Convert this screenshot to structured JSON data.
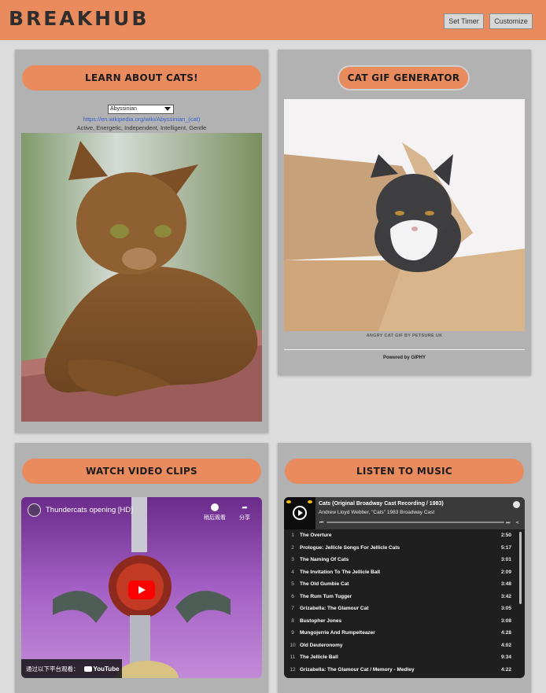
{
  "header": {
    "logo": "BREAKHUB",
    "set_timer_label": "Set Timer",
    "customize_label": "Customize",
    "brand_color": "#e98b5d"
  },
  "learn": {
    "title": "LEARN ABOUT CATS!",
    "breed_select": "Abyssinian",
    "wiki_link": "https://en.wikipedia.org/wiki/Abyssinian_(cat)",
    "traits": "Active, Energetic, Independent, Intelligent, Gentle"
  },
  "gif": {
    "title": "CAT GIF GENERATOR",
    "credit": "ANGRY CAT GIF BY PETSURE UK",
    "powered_by": "Powered by GIPHY"
  },
  "video": {
    "title": "WATCH VIDEO CLIPS",
    "video_title": "Thundercats opening [HD]",
    "watch_later": "稍后观看",
    "share": "分享",
    "platform_text": "通过以下平台观看：",
    "platform_logo": "YouTube"
  },
  "music": {
    "title": "LISTEN TO MUSIC",
    "album": "Cats (Original Broadway Cast Recording / 1983)",
    "artist": "Andrew Lloyd Webber, \"Cats\" 1983 Broadway Cast",
    "tracks": [
      {
        "n": "1",
        "title": "The Overture",
        "dur": "2:50"
      },
      {
        "n": "2",
        "title": "Prologue: Jellicle Songs For Jellicle Cats",
        "dur": "5:17"
      },
      {
        "n": "3",
        "title": "The Naming Of Cats",
        "dur": "3:01"
      },
      {
        "n": "4",
        "title": "The Invitation To The Jellicle Ball",
        "dur": "2:09"
      },
      {
        "n": "5",
        "title": "The Old Gumbie Cat",
        "dur": "3:48"
      },
      {
        "n": "6",
        "title": "The Rum Tum Tugger",
        "dur": "3:42"
      },
      {
        "n": "7",
        "title": "Grizabella: The Glamour Cat",
        "dur": "3:05"
      },
      {
        "n": "8",
        "title": "Bustopher Jones",
        "dur": "3:08"
      },
      {
        "n": "9",
        "title": "Mungojerrie And Rumpelteazer",
        "dur": "4:28"
      },
      {
        "n": "10",
        "title": "Old Deuteronomy",
        "dur": "4:02"
      },
      {
        "n": "11",
        "title": "The Jellicle Ball",
        "dur": "9:34"
      },
      {
        "n": "12",
        "title": "Grizabella: The Glamour Cat / Memory - Medley",
        "dur": "4:22"
      }
    ]
  }
}
